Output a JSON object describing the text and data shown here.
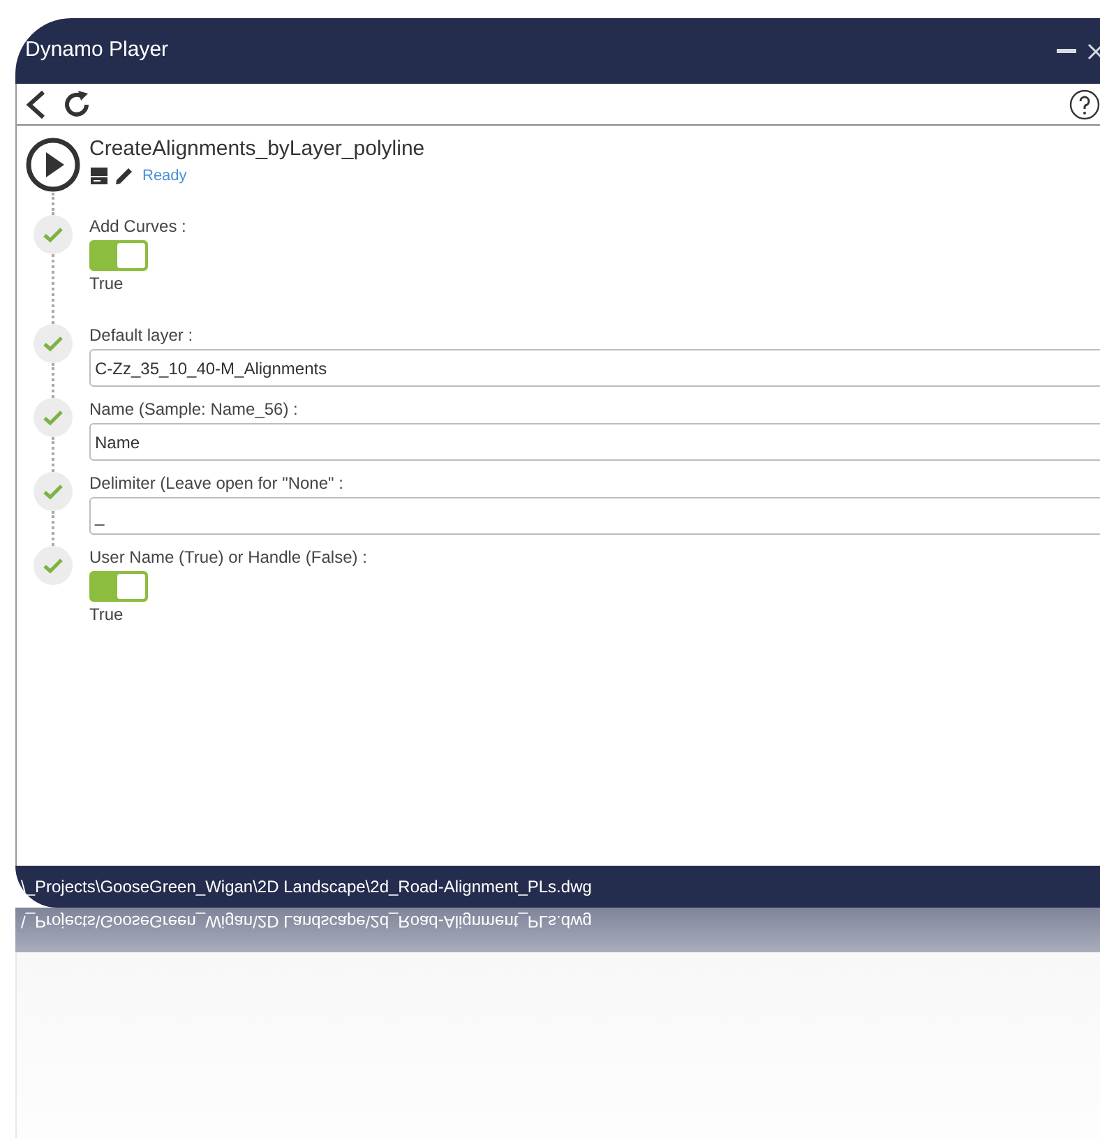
{
  "window": {
    "title": "Dynamo Player"
  },
  "script": {
    "name": "CreateAlignments_byLayer_polyline",
    "status": "Ready"
  },
  "inputs": [
    {
      "kind": "toggle",
      "label": "Add Curves :",
      "on": true,
      "value": "True",
      "done": true
    },
    {
      "kind": "text",
      "label": "Default layer :",
      "value": "C-Zz_35_10_40-M_Alignments",
      "done": true
    },
    {
      "kind": "text",
      "label": "Name (Sample: Name_56) :",
      "value": "Name",
      "done": true
    },
    {
      "kind": "text",
      "label": "Delimiter (Leave open for \"None\" :",
      "value": "_",
      "done": true
    },
    {
      "kind": "toggle",
      "label": "User Name (True) or Handle (False) :",
      "on": true,
      "value": "True",
      "done": true
    }
  ],
  "status_bar": {
    "path": "\\_Projects\\GooseGreen_Wigan\\2D Landscape\\2d_Road-Alignment_PLs.dwg"
  },
  "reflection": {
    "text": "\\_Projects\\GooseGreen_Wigan\\2D Landscape\\2d_Road-Alignment_PLs.dwg"
  }
}
